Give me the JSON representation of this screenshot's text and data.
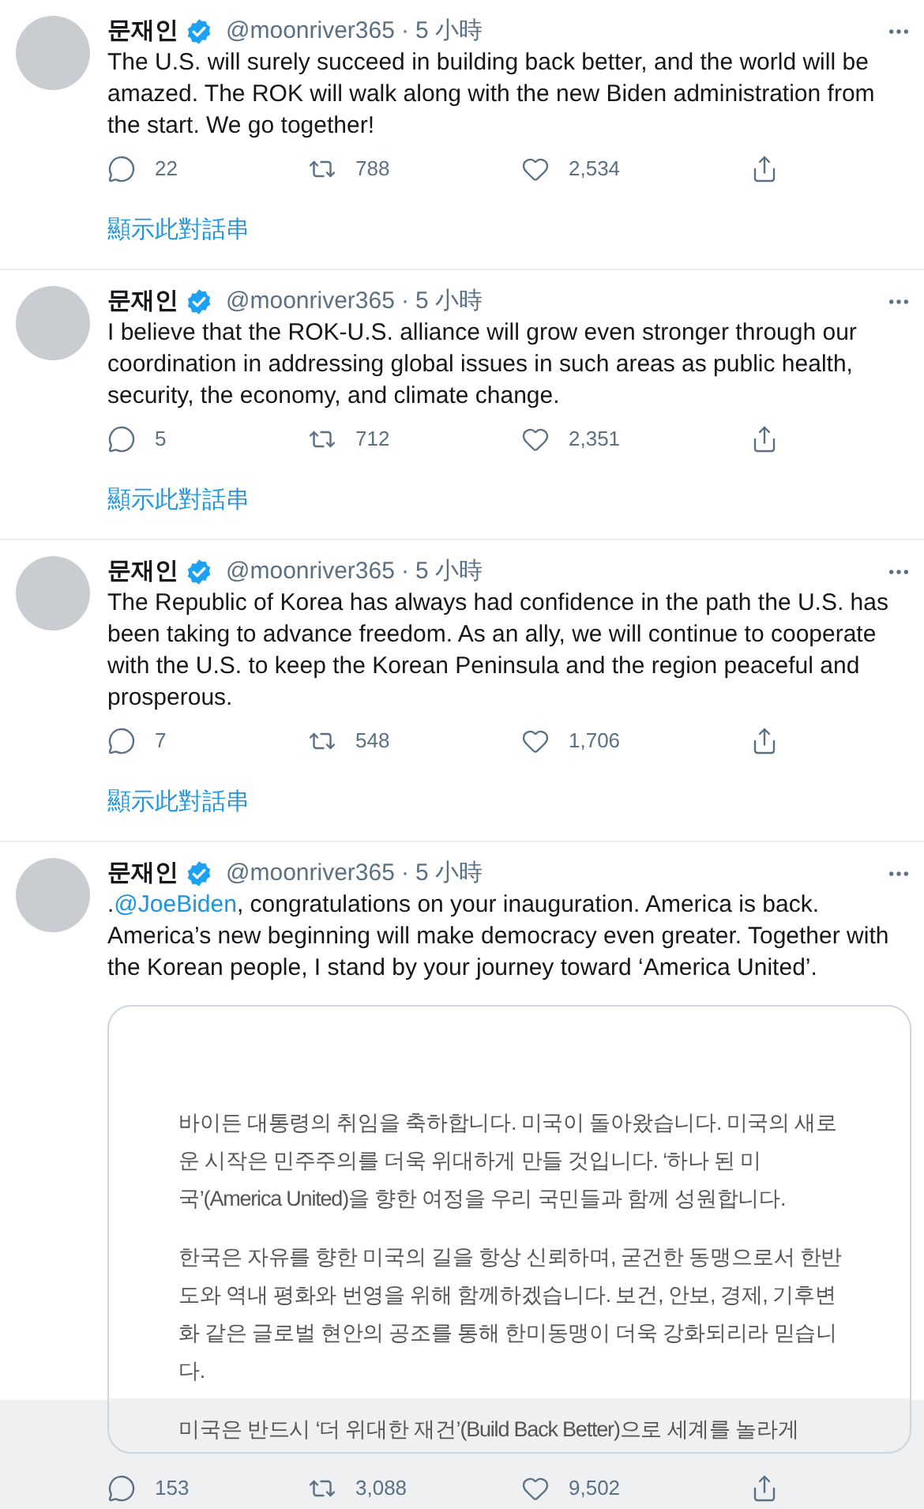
{
  "tweets": [
    {
      "name": "문재인",
      "verified": true,
      "handle": "@moonriver365",
      "separator": "·",
      "time": "5 小時",
      "text": "The U.S. will surely succeed in building back better, and the world will be amazed. The ROK will walk along with the new Biden administration from the start. We go together!",
      "replies": "22",
      "retweets": "788",
      "likes": "2,534",
      "show_thread": "顯示此對話串"
    },
    {
      "name": "문재인",
      "verified": true,
      "handle": "@moonriver365",
      "separator": "·",
      "time": "5 小時",
      "text": "I believe that the ROK-U.S. alliance will grow even stronger through our coordination in addressing global issues in such areas as public health, security, the economy, and climate change.",
      "replies": "5",
      "retweets": "712",
      "likes": "2,351",
      "show_thread": "顯示此對話串"
    },
    {
      "name": "문재인",
      "verified": true,
      "handle": "@moonriver365",
      "separator": "·",
      "time": "5 小時",
      "text": "The Republic of Korea has always had confidence in the path the U.S. has been taking to advance freedom. As an ally, we will continue to cooperate with the U.S. to keep the Korean Peninsula and the region peaceful and prosperous.",
      "replies": "7",
      "retweets": "548",
      "likes": "1,706",
      "show_thread": "顯示此對話串"
    },
    {
      "name": "문재인",
      "verified": true,
      "handle": "@moonriver365",
      "separator": "·",
      "time": "5 小時",
      "lead": ".",
      "mention": "@JoeBiden",
      "text": ", congratulations on your inauguration. America is back. America’s new beginning will make democracy even greater. Together with the Korean people, I stand by your journey toward ‘America United’.",
      "hovered": true,
      "image_paragraphs": [
        "바이든 대통령의 취임을 축하합니다. 미국이 돌아왔습니다. 미국의 새로운 시작은 민주주의를 더욱 위대하게 만들 것입니다. ‘하나 된 미국’(America United)을 향한 여정을 우리 국민들과 함께 성원합니다.",
        "한국은 자유를 향한 미국의 길을 항상 신뢰하며, 굳건한 동맹으로서 한반도와 역내 평화와 번영을 위해 함께하겠습니다. 보건, 안보, 경제, 기후변화 같은 글로벌 현안의 공조를 통해 한미동맹이 더욱 강화되리라 믿습니다.",
        "미국은 반드시 ‘더 위대한 재건’(Build Back Better)으로 세계를 놀라게"
      ],
      "replies": "153",
      "retweets": "3,088",
      "likes": "9,502"
    }
  ]
}
